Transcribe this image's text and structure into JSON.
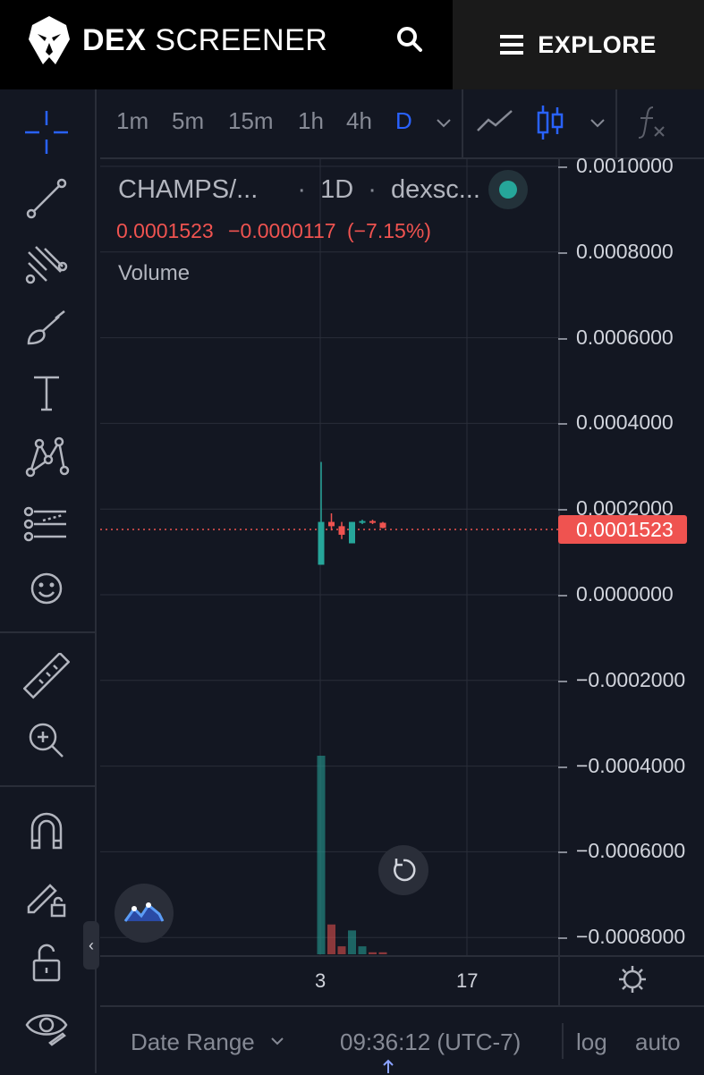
{
  "header": {
    "brand_bold": "DEX",
    "brand_light": "SCREENER",
    "explore_label": "EXPLORE",
    "brand_logo": "eagle-logo",
    "search_icon": "search-icon",
    "menu_icon": "hamburger-icon"
  },
  "timeframes": [
    "1m",
    "5m",
    "15m",
    "1h",
    "4h",
    "D"
  ],
  "active_timeframe": "D",
  "legend": {
    "pair": "CHAMPS/...",
    "dot": "·",
    "interval": "1D",
    "source": "dexsc...",
    "close": "0.0001523",
    "change": "−0.0000117",
    "change_pct": "(−7.15%)",
    "volume_label": "Volume"
  },
  "price_axis": {
    "labels": [
      "0.0010000",
      "0.0008000",
      "0.0006000",
      "0.0004000",
      "0.0002000",
      "0.0000000",
      "−0.0002000",
      "−0.0004000",
      "−0.0006000",
      "−0.0008000"
    ],
    "current_price": "0.0001523"
  },
  "time_axis": {
    "labels": [
      "3",
      "17"
    ]
  },
  "bottom_bar": {
    "date_range": "Date Range",
    "time": "09:36:12 (UTC-7)",
    "log": "log",
    "auto": "auto"
  },
  "colors": {
    "up": "#26a69a",
    "down": "#ef5350",
    "accent": "#2962ff",
    "background": "#131722"
  },
  "chart_data": {
    "type": "candlestick",
    "interval": "1D",
    "ylim": [
      -0.0009,
      0.001
    ],
    "current_price": 0.0001523,
    "candles": [
      {
        "open": 7e-05,
        "high": 0.00031,
        "low": 7e-05,
        "close": 0.00017,
        "volume": 1.0
      },
      {
        "open": 0.00017,
        "high": 0.00019,
        "low": 0.00015,
        "close": 0.00016,
        "volume": 0.15
      },
      {
        "open": 0.00016,
        "high": 0.00017,
        "low": 0.00013,
        "close": 0.00014,
        "volume": 0.04
      },
      {
        "open": 0.00012,
        "high": 0.00017,
        "low": 0.00012,
        "close": 0.00017,
        "volume": 0.12
      },
      {
        "open": 0.00017,
        "high": 0.000175,
        "low": 0.000165,
        "close": 0.000172,
        "volume": 0.04
      },
      {
        "open": 0.000172,
        "high": 0.000175,
        "low": 0.000165,
        "close": 0.000168,
        "volume": 0.01
      },
      {
        "open": 0.000168,
        "high": 0.00017,
        "low": 0.000155,
        "close": 0.000156,
        "volume": 0.01
      }
    ]
  }
}
